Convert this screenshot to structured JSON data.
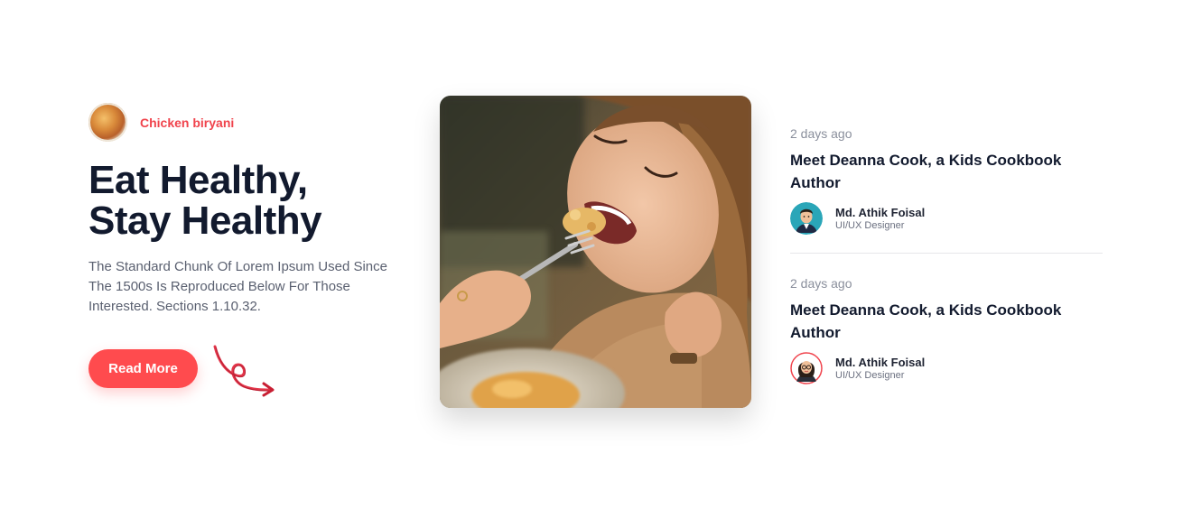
{
  "hero": {
    "tag_label": "Chicken biryani",
    "title_line1": "Eat Healthy,",
    "title_line2": "Stay Healthy",
    "description": "The Standard Chunk Of Lorem Ipsum Used Since The 1500s Is Reproduced Below For Those Interested. Sections 1.10.32.",
    "button_label": "Read More"
  },
  "posts": [
    {
      "time": "2 days ago",
      "title": "Meet Deanna Cook, a Kids Cookbook Author",
      "author_name": "Md. Athik Foisal",
      "author_role": "UI/UX Designer",
      "avatar_icon": "man-avatar"
    },
    {
      "time": "2 days ago",
      "title": "Meet Deanna Cook, a Kids Cookbook Author",
      "author_name": "Md. Athik Foisal",
      "author_role": "UI/UX Designer",
      "avatar_icon": "woman-avatar"
    }
  ],
  "colors": {
    "accent": "#ff4b4e",
    "heading": "#121a2e",
    "muted": "#8a8f9c"
  }
}
